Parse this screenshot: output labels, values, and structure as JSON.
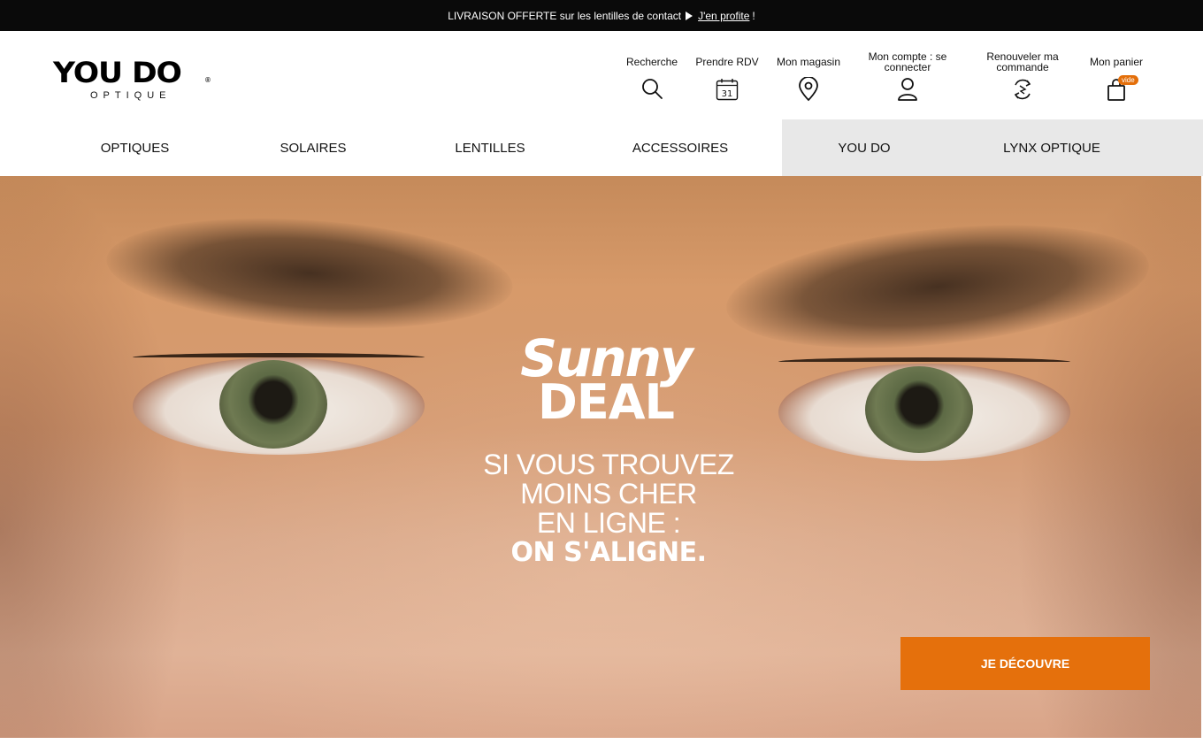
{
  "promo": {
    "text": "LIVRAISON OFFERTE sur les lentilles de contact",
    "link": "J'en profite",
    "suffix": "!"
  },
  "logo": {
    "main": "YOU DO",
    "sub": "OPTIQUE",
    "reg": "®"
  },
  "tools": {
    "search": "Recherche",
    "appointment": "Prendre RDV",
    "calendar_day": "31",
    "store": "Mon magasin",
    "account": "Mon compte : se connecter",
    "renew": "Renouveler ma commande",
    "cart": "Mon panier",
    "cart_badge": "vide"
  },
  "nav": {
    "items": [
      "OPTIQUES",
      "SOLAIRES",
      "LENTILLES",
      "ACCESSOIRES",
      "YOU DO",
      "LYNX OPTIQUE"
    ]
  },
  "hero": {
    "title_1": "Sunny",
    "title_2": "DEAL",
    "line_1": "SI VOUS TROUVEZ",
    "line_2": "MOINS CHER",
    "line_3": "EN LIGNE :",
    "line_4": "ON S'ALIGNE.",
    "cta": "JE DÉCOUVRE"
  },
  "colors": {
    "accent": "#e5700c",
    "promo_bg": "#0a0a0a",
    "nav_grey": "#e8e8e8"
  }
}
